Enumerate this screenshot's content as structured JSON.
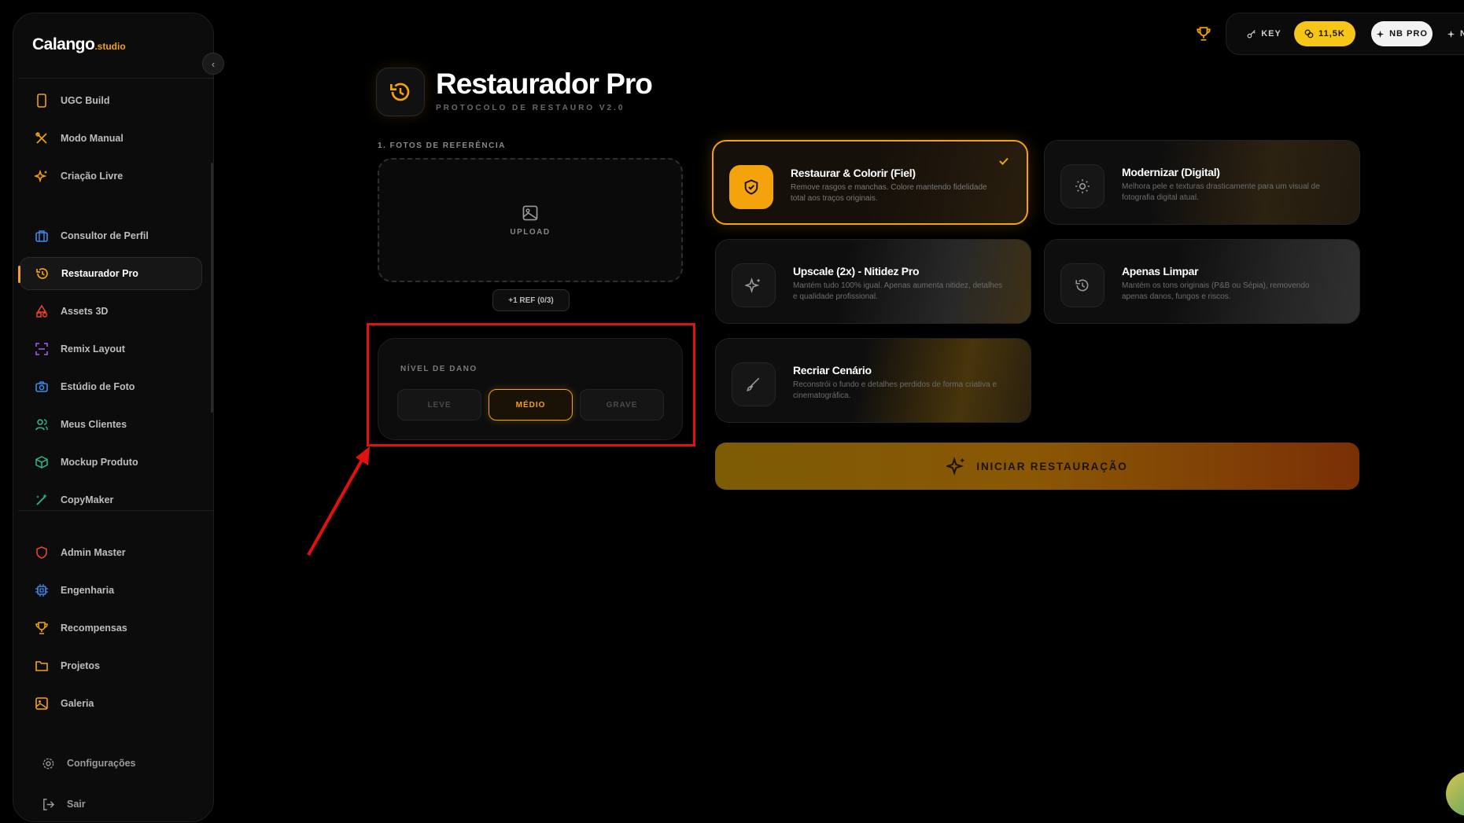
{
  "app": {
    "logo_main": "Calango",
    "logo_suffix": ".studio"
  },
  "sidebar": {
    "items": [
      {
        "label": "UGC Build",
        "icon": "phone-icon"
      },
      {
        "label": "Modo Manual",
        "icon": "tools-icon"
      },
      {
        "label": "Criação Livre",
        "icon": "sparkles-icon"
      },
      {
        "label": "Consultor de Perfil",
        "icon": "briefcase-icon"
      },
      {
        "label": "Restaurador Pro",
        "icon": "history-icon",
        "active": true
      },
      {
        "label": "Assets 3D",
        "icon": "shapes-icon"
      },
      {
        "label": "Remix Layout",
        "icon": "scan-icon"
      },
      {
        "label": "Estúdio de Foto",
        "icon": "camera-icon"
      },
      {
        "label": "Meus Clientes",
        "icon": "users-icon"
      },
      {
        "label": "Mockup Produto",
        "icon": "box-icon"
      },
      {
        "label": "CopyMaker",
        "icon": "wand-icon"
      },
      {
        "label": "Admin Master",
        "icon": "shield-icon"
      },
      {
        "label": "Engenharia",
        "icon": "cpu-icon"
      },
      {
        "label": "Recompensas",
        "icon": "trophy-icon"
      },
      {
        "label": "Projetos",
        "icon": "folder-icon"
      },
      {
        "label": "Galeria",
        "icon": "image-icon"
      }
    ],
    "footer": {
      "settings_label": "Configurações",
      "logout_label": "Sair"
    }
  },
  "topbar": {
    "key_label": "KEY",
    "credits_label": "11,5K",
    "nbpro_label": "NB PRO",
    "more_label": "N"
  },
  "header": {
    "title": "Restaurador Pro",
    "subtitle": "PROTOCOLO DE RESTAURO V2.0"
  },
  "reference": {
    "label": "1. FOTOS DE REFERÊNCIA",
    "upload_label": "UPLOAD",
    "add_ref_label": "+1 REF (0/3)"
  },
  "damage": {
    "label": "NÍVEL DE DANO",
    "options": [
      "LEVE",
      "MÉDIO",
      "GRAVE"
    ],
    "selected": "MÉDIO"
  },
  "modes": [
    {
      "title": "Restaurar & Colorir (Fiel)",
      "desc": "Remove rasgos e manchas. Colore mantendo fidelidade total aos traços originais.",
      "icon": "shield-check-icon",
      "selected": true
    },
    {
      "title": "Modernizar (Digital)",
      "desc": "Melhora pele e texturas drasticamente para um visual de fotografia digital atual.",
      "icon": "sun-icon"
    },
    {
      "title": "Upscale (2x) - Nitidez Pro",
      "desc": "Mantém tudo 100% igual. Apenas aumenta nitidez, detalhes e qualidade profissional.",
      "icon": "sparkles-icon"
    },
    {
      "title": "Apenas Limpar",
      "desc": "Mantém os tons originais (P&B ou Sépia), removendo apenas danos, fungos e riscos.",
      "icon": "history-icon"
    },
    {
      "title": "Recriar Cenário",
      "desc": "Reconstrói o fundo e detalhes perdidos de forma criativa e cinematográfica.",
      "icon": "brush-icon"
    }
  ],
  "cta": {
    "label": "INICIAR RESTAURAÇÃO"
  },
  "colors": {
    "accent": "#f5a30c",
    "credits": "#f5c518",
    "annotation": "#e31010"
  }
}
